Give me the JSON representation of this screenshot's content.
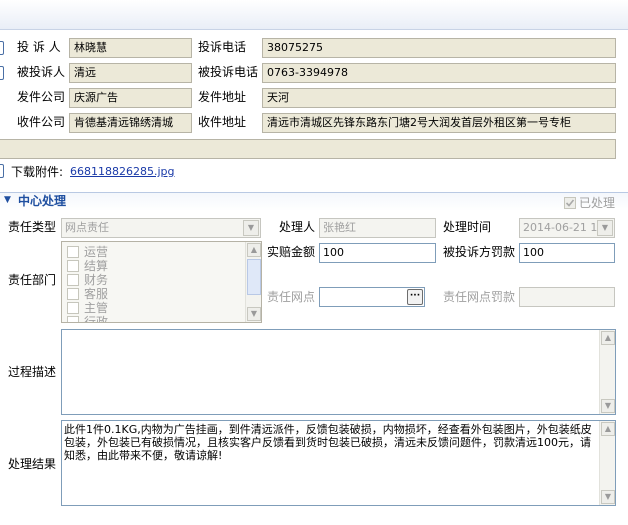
{
  "complaint": {
    "complainant_label": "投 诉 人",
    "complainant_value": "林晓慧",
    "complaint_phone_label": "投诉电话",
    "complaint_phone_value": "38075275",
    "respondent_label": "被投诉人",
    "respondent_value": "清远",
    "respondent_phone_label": "被投诉电话",
    "respondent_phone_value": "0763-3394978",
    "sender_company_label": "发件公司",
    "sender_company_value": "庆源广告",
    "sender_address_label": "发件地址",
    "sender_address_value": "天河",
    "receiver_company_label": "收件公司",
    "receiver_company_value": "肯德基清远锦绣清城",
    "receiver_address_label": "收件地址",
    "receiver_address_value": "清远市清城区先锋东路东门塘2号大润发首层外租区第一号专柜",
    "download_label": "下载附件:",
    "download_link": "668118826285.jpg"
  },
  "center": {
    "section_title": "中心处理",
    "processed_label": "已处理",
    "resp_type_label": "责任类型",
    "resp_type_value": "网点责任",
    "handler_label": "处理人",
    "handler_value": "张艳红",
    "time_label": "处理时间",
    "time_value": "2014-06-21 1",
    "compensation_label": "实赔金额",
    "compensation_value": "100",
    "fine_label": "被投诉方罚款",
    "fine_value": "100",
    "dept_label": "责任部门",
    "departments": [
      "运营",
      "结算",
      "财务",
      "客服",
      "主管",
      "行政"
    ],
    "resp_point_label": "责任网点",
    "resp_point_button": "···",
    "point_fine_label": "责任网点罚款",
    "process_desc_label": "过程描述",
    "result_label": "处理结果",
    "result_text": "此件1件0.1KG,内物为广告挂画，到件清远派件，反馈包装破损，内物损坏，经查看外包装图片，外包装纸皮包装，外包装已有破损情况，且核实客户反馈看到货时包装已破损，清远未反馈问题件，罚款清远100元，请知悉，由此带来不便，敬请谅解!"
  }
}
